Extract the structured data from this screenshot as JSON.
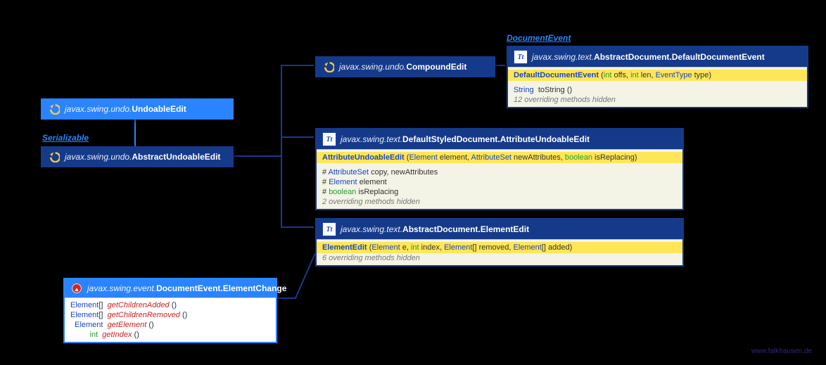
{
  "colors": {
    "lightBlue": "#2a84ff",
    "darkBlue": "#163a8a",
    "body": "#f3f3e6",
    "hl": "#ffe658"
  },
  "superscripts": {
    "serializable": "Serializable",
    "documentEvent": "DocumentEvent"
  },
  "nodes": {
    "undoableEdit": {
      "pkg": "javax.swing.undo.",
      "cls": "UndoableEdit"
    },
    "abstractUndoableEdit": {
      "pkg": "javax.swing.undo.",
      "cls": "AbstractUndoableEdit"
    },
    "compoundEdit": {
      "pkg": "javax.swing.undo.",
      "cls": "CompoundEdit"
    },
    "defaultDocumentEvent": {
      "pkg": "javax.swing.text.",
      "cls": "AbstractDocument.DefaultDocumentEvent",
      "ctor": {
        "name": "DefaultDocumentEvent",
        "params": [
          {
            "t": "int",
            "n": "offs"
          },
          {
            "t": "int",
            "n": "len"
          },
          {
            "t": "EventType",
            "n": "type",
            "link": true
          }
        ]
      },
      "rows": [
        {
          "ret": "String",
          "name": "toString",
          "params": "()"
        },
        {
          "note": "12 overriding methods hidden"
        }
      ]
    },
    "attributeUndoableEdit": {
      "pkg": "javax.swing.text.",
      "cls": "DefaultStyledDocument.AttributeUndoableEdit",
      "ctor": {
        "name": "AttributeUndoableEdit",
        "params": [
          {
            "t": "Element",
            "n": "element",
            "link": true
          },
          {
            "t": "AttributeSet",
            "n": "newAttributes",
            "link": true
          },
          {
            "t": "boolean",
            "n": "isReplacing",
            "kw": true
          }
        ]
      },
      "fields": [
        {
          "t": "AttributeSet",
          "names": "copy, newAttributes",
          "link": true
        },
        {
          "t": "Element",
          "names": "element",
          "link": true
        },
        {
          "t": "boolean",
          "names": "isReplacing",
          "kw": true
        }
      ],
      "note": "2 overriding methods hidden"
    },
    "elementEdit": {
      "pkg": "javax.swing.text.",
      "cls": "AbstractDocument.ElementEdit",
      "ctor": {
        "name": "ElementEdit",
        "params": [
          {
            "t": "Element",
            "n": "e",
            "link": true
          },
          {
            "t": "int",
            "n": "index"
          },
          {
            "t": "Element[]",
            "n": "removed",
            "link": true
          },
          {
            "t": "Element[]",
            "n": "added",
            "link": true
          }
        ]
      },
      "note": "6 overriding methods hidden"
    },
    "elementChange": {
      "pkg": "javax.swing.event.",
      "cls": "DocumentEvent.ElementChange",
      "methods": [
        {
          "ret": "Element[]",
          "name": "getChildrenAdded",
          "params": "()"
        },
        {
          "ret": "Element[]",
          "name": "getChildrenRemoved",
          "params": "()"
        },
        {
          "ret": "Element",
          "name": "getElement",
          "params": "()"
        },
        {
          "ret": "int",
          "name": "getIndex",
          "params": "()"
        }
      ]
    }
  },
  "footer": "www.falkhausen.de"
}
